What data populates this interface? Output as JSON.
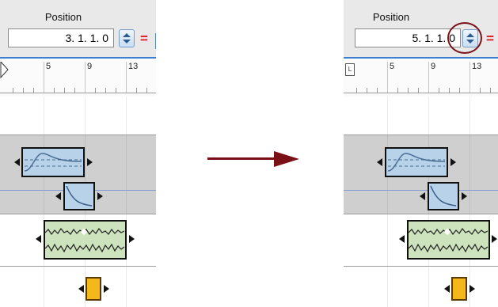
{
  "before": {
    "position_label": "Position",
    "position_value": "3.  1.  1.    0",
    "equals_sign": "=",
    "ruler_labels": [
      "5",
      "9",
      "13"
    ]
  },
  "after": {
    "position_label": "Position",
    "position_value": "5.  1.  1.    0",
    "equals_sign": "=",
    "ruler_labels": [
      "5",
      "9",
      "13"
    ],
    "locator_label": "L"
  },
  "colors": {
    "arrow": "#7a0f16",
    "highlight": "#7a1318",
    "equals": "#e0141e",
    "ruler_accent": "#3f7fd1"
  }
}
